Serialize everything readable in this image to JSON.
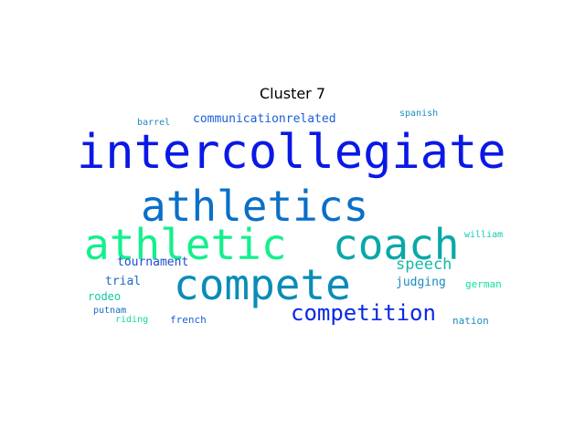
{
  "figure": {
    "title": "Cluster 7"
  },
  "words": [
    {
      "text": "intercollegiate",
      "color": "#0a18e6"
    },
    {
      "text": "athletics",
      "color": "#0a6fc8"
    },
    {
      "text": "athletic",
      "color": "#12f08c"
    },
    {
      "text": "coach",
      "color": "#0aa8a8"
    },
    {
      "text": "compete",
      "color": "#0a8cb8"
    },
    {
      "text": "competition",
      "color": "#0a28e6"
    },
    {
      "text": "speech",
      "color": "#14b8a6"
    },
    {
      "text": "communicationrelated",
      "color": "#1a5fd8"
    },
    {
      "text": "tournament",
      "color": "#1a4fd0"
    },
    {
      "text": "judging",
      "color": "#1a8cc0"
    },
    {
      "text": "trial",
      "color": "#1a6ac8"
    },
    {
      "text": "rodeo",
      "color": "#12c8a0"
    },
    {
      "text": "putnam",
      "color": "#1a6ac8"
    },
    {
      "text": "riding",
      "color": "#12d8a0"
    },
    {
      "text": "french",
      "color": "#1a5fd8"
    },
    {
      "text": "barrel",
      "color": "#1a8cb8"
    },
    {
      "text": "spanish",
      "color": "#1a8cc8"
    },
    {
      "text": "william",
      "color": "#12c8b0"
    },
    {
      "text": "german",
      "color": "#12e0a0"
    },
    {
      "text": "nation",
      "color": "#1a8cc0"
    }
  ]
}
